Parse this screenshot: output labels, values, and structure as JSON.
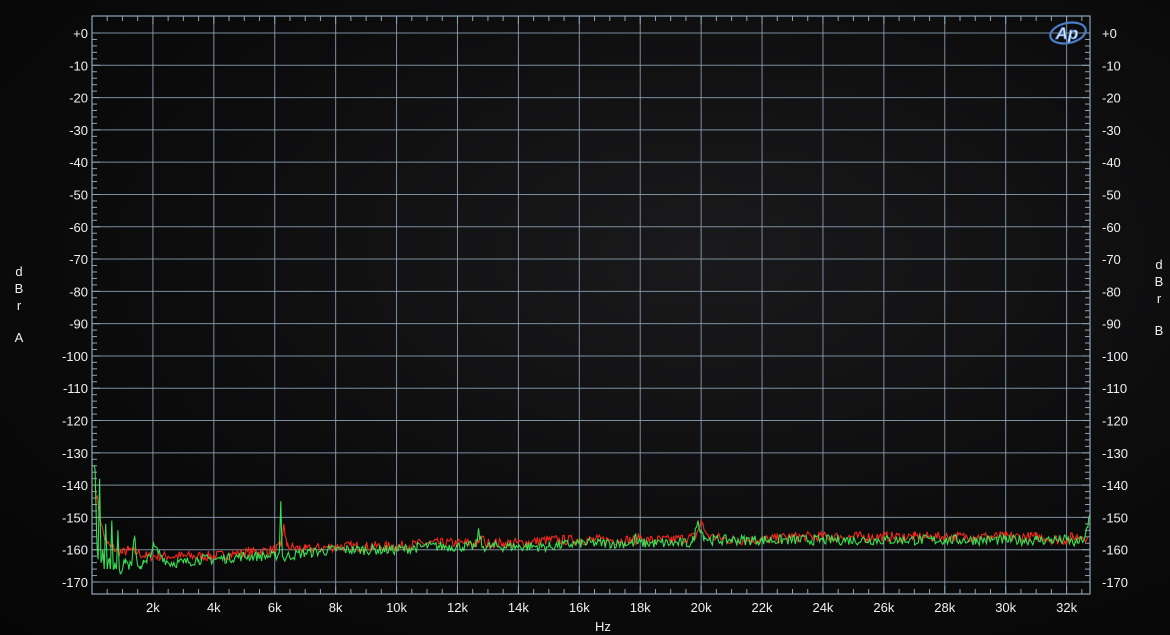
{
  "brand": {
    "logo_text": "Ap",
    "logo_color": "#4a7ec8"
  },
  "colors": {
    "background": "#0c0c0d",
    "grid": "#8fa4b8",
    "text": "#f0f0f0",
    "channel_a": "#ff2a1a",
    "channel_b": "#3cf25a"
  },
  "chart_data": {
    "type": "line",
    "xlabel": "Hz",
    "ylabel_left": [
      "d",
      "B",
      "r",
      "A"
    ],
    "ylabel_right": [
      "d",
      "B",
      "r",
      "B"
    ],
    "xlim": [
      0,
      32768
    ],
    "ylim": [
      -170,
      5
    ],
    "x_ticks": [
      {
        "value": 2000,
        "label": "2k"
      },
      {
        "value": 4000,
        "label": "4k"
      },
      {
        "value": 6000,
        "label": "6k"
      },
      {
        "value": 8000,
        "label": "8k"
      },
      {
        "value": 10000,
        "label": "10k"
      },
      {
        "value": 12000,
        "label": "12k"
      },
      {
        "value": 14000,
        "label": "14k"
      },
      {
        "value": 16000,
        "label": "16k"
      },
      {
        "value": 18000,
        "label": "18k"
      },
      {
        "value": 20000,
        "label": "20k"
      },
      {
        "value": 22000,
        "label": "22k"
      },
      {
        "value": 24000,
        "label": "24k"
      },
      {
        "value": 26000,
        "label": "26k"
      },
      {
        "value": 28000,
        "label": "28k"
      },
      {
        "value": 30000,
        "label": "30k"
      },
      {
        "value": 32000,
        "label": "32k"
      }
    ],
    "y_ticks_left": [
      {
        "value": 0,
        "label": "+0"
      },
      {
        "value": -10,
        "label": "-10"
      },
      {
        "value": -20,
        "label": "-20"
      },
      {
        "value": -30,
        "label": "-30"
      },
      {
        "value": -40,
        "label": "-40"
      },
      {
        "value": -50,
        "label": "-50"
      },
      {
        "value": -60,
        "label": "-60"
      },
      {
        "value": -70,
        "label": "-70"
      },
      {
        "value": -80,
        "label": "-80"
      },
      {
        "value": -90,
        "label": "-90"
      },
      {
        "value": -100,
        "label": "-100"
      },
      {
        "value": -110,
        "label": "-110"
      },
      {
        "value": -120,
        "label": "-120"
      },
      {
        "value": -130,
        "label": "-130"
      },
      {
        "value": -140,
        "label": "-140"
      },
      {
        "value": -150,
        "label": "-150"
      },
      {
        "value": -160,
        "label": "-160"
      },
      {
        "value": -170,
        "label": "-170"
      }
    ],
    "y_ticks_right": [
      {
        "value": 0,
        "label": "+0"
      },
      {
        "value": -10,
        "label": "-10"
      },
      {
        "value": -20,
        "label": "-20"
      },
      {
        "value": -30,
        "label": "-30"
      },
      {
        "value": -40,
        "label": "-40"
      },
      {
        "value": -50,
        "label": "-50"
      },
      {
        "value": -60,
        "label": "-60"
      },
      {
        "value": -70,
        "label": "-70"
      },
      {
        "value": -80,
        "label": "-80"
      },
      {
        "value": -90,
        "label": "-90"
      },
      {
        "value": -100,
        "label": "-100"
      },
      {
        "value": -110,
        "label": "-110"
      },
      {
        "value": -120,
        "label": "-120"
      },
      {
        "value": -130,
        "label": "-130"
      },
      {
        "value": -140,
        "label": "-140"
      },
      {
        "value": -150,
        "label": "-150"
      },
      {
        "value": -160,
        "label": "-160"
      },
      {
        "value": -170,
        "label": "-170"
      }
    ],
    "grid": true,
    "series": [
      {
        "channel": "A",
        "color": "#ff2a1a",
        "x": [
          100,
          200,
          300,
          400,
          500,
          600,
          800,
          1000,
          1200,
          1500,
          1800,
          2000,
          2500,
          3000,
          4000,
          5000,
          6000,
          6200,
          6300,
          6400,
          7000,
          8000,
          9000,
          10000,
          11000,
          12000,
          12700,
          12800,
          12900,
          13500,
          14000,
          15000,
          16000,
          17000,
          17900,
          18000,
          18100,
          19000,
          19800,
          19900,
          20000,
          20100,
          20300,
          21000,
          22000,
          23000,
          24000,
          25000,
          26000,
          27000,
          28000,
          29000,
          30000,
          31000,
          31800,
          32000,
          32200,
          32500,
          32700
        ],
        "y": [
          -140,
          -146,
          -152,
          -156,
          -158,
          -159,
          -160,
          -161,
          -160,
          -161,
          -162,
          -162,
          -162,
          -162,
          -162,
          -161,
          -160,
          -159,
          -152,
          -159,
          -160,
          -159,
          -159,
          -159,
          -158,
          -158,
          -158,
          -156,
          -158,
          -158,
          -158,
          -157,
          -157,
          -157,
          -157,
          -156,
          -157,
          -157,
          -156,
          -154,
          -151,
          -154,
          -156,
          -157,
          -157,
          -156,
          -156,
          -156,
          -156,
          -156,
          -156,
          -156,
          -156,
          -156,
          -157,
          -157,
          -156,
          -156,
          -156
        ]
      },
      {
        "channel": "B",
        "color": "#3cf25a",
        "x": [
          50,
          100,
          150,
          200,
          250,
          300,
          350,
          400,
          450,
          500,
          550,
          600,
          650,
          700,
          750,
          800,
          850,
          900,
          1000,
          1100,
          1200,
          1300,
          1400,
          1500,
          1600,
          1700,
          1800,
          2000,
          2500,
          3000,
          3500,
          4000,
          5000,
          5500,
          6000,
          6150,
          6200,
          6250,
          6300,
          6400,
          7000,
          8000,
          9000,
          10000,
          11000,
          12000,
          12600,
          12700,
          12800,
          13000,
          14000,
          15000,
          16000,
          17000,
          17800,
          17850,
          17900,
          18500,
          19000,
          19700,
          19800,
          19850,
          19900,
          20000,
          20100,
          20300,
          21000,
          22000,
          23000,
          24000,
          25000,
          26000,
          27000,
          28000,
          29000,
          30000,
          31000,
          31500,
          32000,
          32300,
          32500,
          32600,
          32700,
          32768
        ],
        "y": [
          -134,
          -135,
          -155,
          -163,
          -138,
          -164,
          -160,
          -166,
          -152,
          -166,
          -163,
          -166,
          -151,
          -166,
          -164,
          -166,
          -154,
          -166,
          -166,
          -163,
          -165,
          -165,
          -156,
          -165,
          -165,
          -164,
          -164,
          -159,
          -164,
          -164,
          -163,
          -163,
          -162,
          -162,
          -162,
          -161,
          -145,
          -162,
          -163,
          -162,
          -161,
          -160,
          -160,
          -160,
          -159,
          -159,
          -159,
          -154,
          -159,
          -159,
          -159,
          -159,
          -158,
          -158,
          -158,
          -155,
          -158,
          -158,
          -158,
          -158,
          -155,
          -153,
          -151,
          -154,
          -156,
          -157,
          -157,
          -157,
          -157,
          -157,
          -157,
          -157,
          -157,
          -157,
          -157,
          -157,
          -157,
          -157,
          -157,
          -158,
          -157,
          -156,
          -153,
          -149
        ]
      }
    ]
  }
}
